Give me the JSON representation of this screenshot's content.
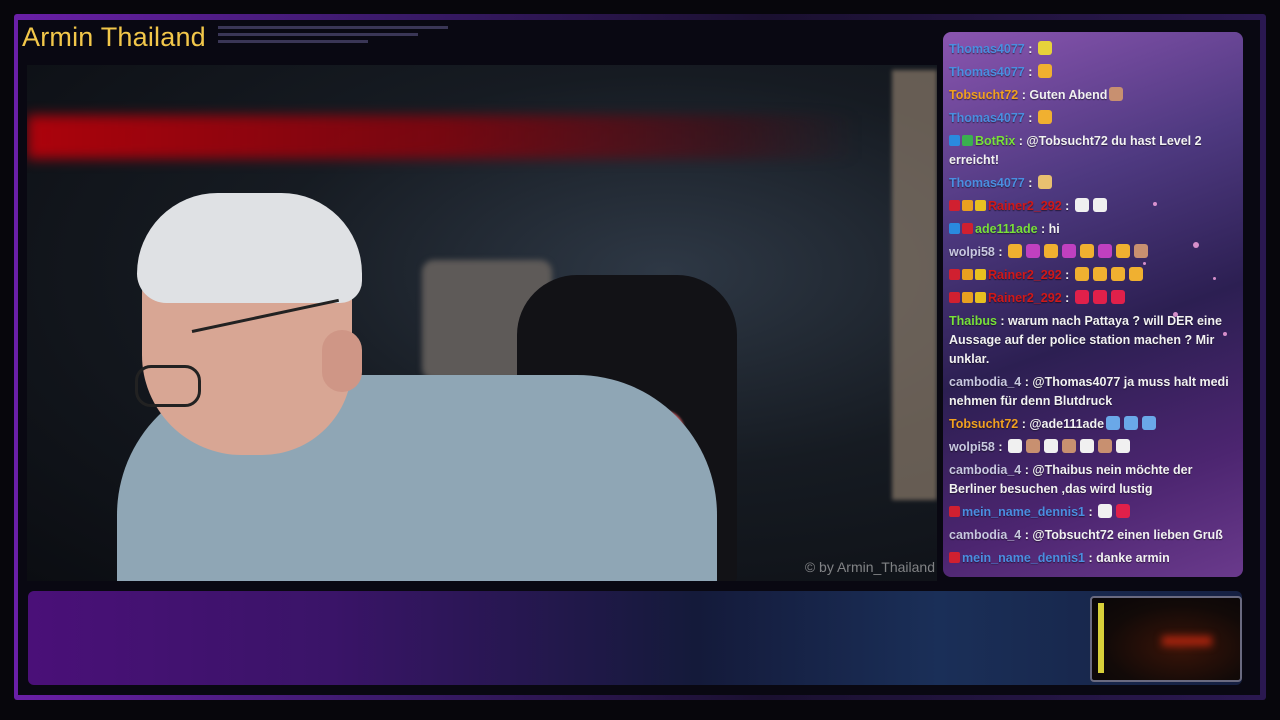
{
  "stream": {
    "channel_title": "Armin Thailand",
    "watermark": "© by Armin_Thailand"
  },
  "colors": {
    "title": "#f2c74a",
    "frame_accent": "#6a1fa8"
  },
  "chat": {
    "messages": [
      {
        "user": "Thomas4077",
        "user_color": "#4a8ee0",
        "text": "",
        "emotes": [
          "face-emote"
        ]
      },
      {
        "user": "Thomas4077",
        "user_color": "#4a8ee0",
        "text": "",
        "emotes": [
          "bars-emote"
        ]
      },
      {
        "user": "Tobsucht72",
        "user_color": "#f0a020",
        "text": "Guten Abend",
        "emotes": [
          "person-emote"
        ]
      },
      {
        "user": "Thomas4077",
        "user_color": "#4a8ee0",
        "text": "",
        "emotes": [
          "bars-emote"
        ]
      },
      {
        "user": "BotRix",
        "user_color": "#78e03a",
        "text": "@Tobsucht72 du hast Level 2 erreicht!",
        "emotes": [],
        "badges": [
          "bot-badge",
          "verified-badge"
        ]
      },
      {
        "user": "Thomas4077",
        "user_color": "#4a8ee0",
        "text": "",
        "emotes": [
          "beer-emote"
        ]
      },
      {
        "user": "Rainer2_292",
        "user_color": "#d01818",
        "text": "",
        "emotes": [
          "soccer-emote",
          "soccer-emote"
        ],
        "badges": [
          "flag-badge",
          "coin-badge",
          "crown-badge"
        ]
      },
      {
        "user": "ade111ade",
        "user_color": "#78e03a",
        "text": "hi",
        "emotes": [],
        "badges": [
          "bot-badge",
          "flag-badge"
        ]
      },
      {
        "user": "wolpi58",
        "user_color": "#c8c8e0",
        "text": "",
        "emotes": [
          "bars-emote",
          "bow-emote",
          "bars-emote",
          "bow-emote",
          "bars-emote",
          "bow-emote",
          "bars-emote",
          "person-emote"
        ]
      },
      {
        "user": "Rainer2_292",
        "user_color": "#d01818",
        "text": "",
        "emotes": [
          "bars-emote",
          "bars-emote",
          "bars-emote",
          "bars-emote"
        ],
        "badges": [
          "flag-badge",
          "coin-badge",
          "crown-badge"
        ]
      },
      {
        "user": "Rainer2_292",
        "user_color": "#d01818",
        "text": "",
        "emotes": [
          "heart-emote",
          "heart-emote",
          "heart-emote"
        ],
        "badges": [
          "flag-badge",
          "coin-badge",
          "crown-badge"
        ]
      },
      {
        "user": "Thaibus",
        "user_color": "#78e03a",
        "text": "warum nach Pattaya ? will DER eine Aussage auf der police station machen ? Mir unklar.",
        "emotes": []
      },
      {
        "user": "cambodia_4",
        "user_color": "#c8c8e0",
        "text": "@Thomas4077 ja muss halt medi nehmen für denn Blutdruck",
        "emotes": []
      },
      {
        "user": "Tobsucht72",
        "user_color": "#f0a020",
        "text": "@ade111ade",
        "emotes": [
          "wave-emote",
          "wave-emote",
          "wave-emote"
        ]
      },
      {
        "user": "wolpi58",
        "user_color": "#c8c8e0",
        "text": "",
        "emotes": [
          "soccer-emote",
          "person-emote",
          "soccer-emote",
          "person-emote",
          "soccer-emote",
          "person-emote",
          "soccer-emote"
        ]
      },
      {
        "user": "cambodia_4",
        "user_color": "#c8c8e0",
        "text": "@Thaibus nein möchte der Berliner besuchen ,das wird lustig",
        "emotes": []
      },
      {
        "user": "mein_name_dennis1",
        "user_color": "#4a8ee0",
        "text": "",
        "emotes": [
          "soccer-emote",
          "heart-emote"
        ],
        "badges": [
          "flag-badge"
        ]
      },
      {
        "user": "cambodia_4",
        "user_color": "#c8c8e0",
        "text": "@Tobsucht72 einen lieben Gruß",
        "emotes": []
      },
      {
        "user": "mein_name_dennis1",
        "user_color": "#4a8ee0",
        "text": "danke armin",
        "emotes": [],
        "badges": [
          "flag-badge"
        ]
      }
    ]
  }
}
